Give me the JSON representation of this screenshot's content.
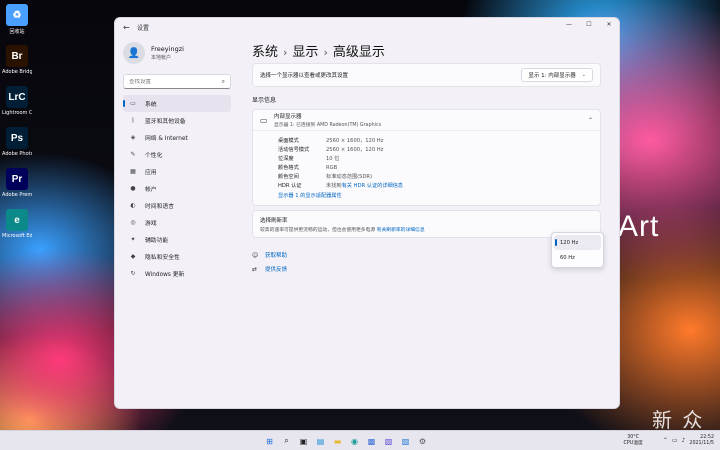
{
  "desktop": {
    "art_text": "Art",
    "watermark": "新 众",
    "icons": [
      {
        "name": "recycle-bin",
        "glyph": "♻",
        "label": "回收站",
        "color": "#4aa0ff"
      },
      {
        "name": "bridge",
        "glyph": "Br",
        "label": "Adobe Bridge",
        "color": "#2a1200"
      },
      {
        "name": "lightroom",
        "glyph": "LrC",
        "label": "Lightroom Classic",
        "color": "#001e36"
      },
      {
        "name": "photoshop",
        "glyph": "Ps",
        "label": "Adobe Photoshop",
        "color": "#001e36"
      },
      {
        "name": "premiere",
        "glyph": "Pr",
        "label": "Adobe Premiere Pro",
        "color": "#00005b"
      },
      {
        "name": "edge",
        "glyph": "e",
        "label": "Microsoft Edge",
        "color": "#0c8a8a"
      }
    ]
  },
  "window": {
    "title": "设置",
    "back_glyph": "←",
    "controls": {
      "minimize": "—",
      "maximize": "☐",
      "close": "✕"
    }
  },
  "sidebar": {
    "user": {
      "name": "Freeyingzi",
      "type": "本地帐户",
      "avatar_glyph": "👤"
    },
    "search": {
      "placeholder": "查找设置",
      "icon": "search-icon",
      "icon_glyph": "⌕"
    },
    "items": [
      {
        "id": "system",
        "label": "系统",
        "icon": "monitor-icon",
        "glyph": "▭",
        "active": true
      },
      {
        "id": "bluetooth",
        "label": "蓝牙和其他设备",
        "icon": "bluetooth-icon",
        "glyph": "ᛒ",
        "active": false
      },
      {
        "id": "network",
        "label": "网络 & Internet",
        "icon": "wifi-icon",
        "glyph": "◈",
        "active": false
      },
      {
        "id": "personalization",
        "label": "个性化",
        "icon": "brush-icon",
        "glyph": "✎",
        "active": false
      },
      {
        "id": "apps",
        "label": "应用",
        "icon": "apps-icon",
        "glyph": "▦",
        "active": false
      },
      {
        "id": "accounts",
        "label": "帐户",
        "icon": "person-icon",
        "glyph": "●",
        "active": false
      },
      {
        "id": "time",
        "label": "时间和语言",
        "icon": "globe-icon",
        "glyph": "◐",
        "active": false
      },
      {
        "id": "gaming",
        "label": "游戏",
        "icon": "gamepad-icon",
        "glyph": "◎",
        "active": false
      },
      {
        "id": "accessibility",
        "label": "辅助功能",
        "icon": "accessibility-icon",
        "glyph": "✦",
        "active": false
      },
      {
        "id": "privacy",
        "label": "隐私和安全性",
        "icon": "shield-icon",
        "glyph": "◆",
        "active": false
      },
      {
        "id": "update",
        "label": "Windows 更新",
        "icon": "update-icon",
        "glyph": "↻",
        "active": false
      }
    ]
  },
  "main": {
    "breadcrumb": [
      "系统",
      "显示",
      "高级显示"
    ],
    "breadcrumb_sep": "›",
    "select_display": {
      "label": "选择一个显示器以查看或更改其设置",
      "value": "显示 1: 内部显示器",
      "chevron": "⌄"
    },
    "display_info_title": "显示信息",
    "display": {
      "name": "内部显示器",
      "sub": "显示器 1: 已连接到 AMD Radeon(TM) Graphics",
      "collapse_glyph": "⌃",
      "monitor_glyph": "▭",
      "rows": [
        {
          "k": "桌面模式",
          "v": "2560 × 1600，120 Hz"
        },
        {
          "k": "活动信号模式",
          "v": "2560 × 1600，120 Hz"
        },
        {
          "k": "位深度",
          "v": "10 位"
        },
        {
          "k": "颜色格式",
          "v": "RGB"
        },
        {
          "k": "颜色空间",
          "v": "标准动态范围(SDR)"
        },
        {
          "k": "HDR 认证",
          "v": "未找到",
          "link": "有关 HDR 认证的详细信息"
        }
      ],
      "adapter_link": "显示器 1 的显示适配器属性"
    },
    "refresh": {
      "title": "选择刷新率",
      "desc": "较高的速率可提供更流畅的运动，但也会使用更多电源",
      "link": "有关刷新率的详细信息",
      "options": [
        "120 Hz",
        "60 Hz"
      ],
      "selected": "120 Hz"
    },
    "help": [
      {
        "label": "获取帮助",
        "icon": "help-icon",
        "glyph": "☺"
      },
      {
        "label": "提供反馈",
        "icon": "feedback-icon",
        "glyph": "⇄"
      }
    ]
  },
  "taskbar": {
    "apps": [
      {
        "name": "start-icon",
        "glyph": "⊞",
        "color": "#1a6fd8"
      },
      {
        "name": "search-icon",
        "glyph": "⌕",
        "color": "#222"
      },
      {
        "name": "taskview-icon",
        "glyph": "▣",
        "color": "#222"
      },
      {
        "name": "widgets-icon",
        "glyph": "▤",
        "color": "#1a8fd8"
      },
      {
        "name": "explorer-icon",
        "glyph": "▬",
        "color": "#e8b830"
      },
      {
        "name": "edge-icon",
        "glyph": "◉",
        "color": "#1a9a9a"
      },
      {
        "name": "store-icon",
        "glyph": "▩",
        "color": "#3a6fd8"
      },
      {
        "name": "mail-icon",
        "glyph": "▧",
        "color": "#5a4ad8"
      },
      {
        "name": "photos-icon",
        "glyph": "▨",
        "color": "#1a7ad8"
      },
      {
        "name": "settings-icon",
        "glyph": "⚙",
        "color": "#555"
      }
    ],
    "weather": {
      "temp": "30°C",
      "desc": "CPU温度"
    },
    "tray_icons": [
      "⌃",
      "▭",
      "♪"
    ],
    "clock": {
      "time": "22:52",
      "date": "2021/11/5"
    }
  }
}
